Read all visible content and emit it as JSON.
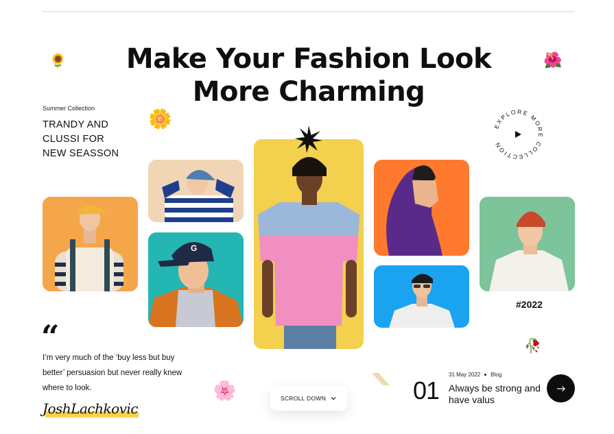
{
  "hero": {
    "title_line1": "Make Your Fashion Look",
    "title_line2": "More Charming"
  },
  "collection": {
    "label": "Summer Collection",
    "heading_line1": "TRANDY AND",
    "heading_line2": "CLUSSI FOR",
    "heading_line3": "NEW SEASSON"
  },
  "explore_badge": {
    "ring_text": "EXPLORE MORE COLLECTION",
    "icon": "play-icon"
  },
  "gallery": {
    "cards": [
      {
        "name": "model-yellow-cap",
        "bg": "#f6a64a"
      },
      {
        "name": "model-striped-sweater",
        "bg": "#f0d6b5"
      },
      {
        "name": "model-navy-cap",
        "bg": "#23b6b2"
      },
      {
        "name": "model-pink-tshirt",
        "bg": "#f3d04e"
      },
      {
        "name": "model-purple-hoodie",
        "bg": "#ff7a2e"
      },
      {
        "name": "model-glasses",
        "bg": "#1aa3f0"
      },
      {
        "name": "model-red-beanie",
        "bg": "#7ec49a"
      }
    ],
    "year_tag": "#2022"
  },
  "testimonial": {
    "quote_mark": "“",
    "text": "I’m very much of the ‘buy less but buy better’ persuasion but never really knew where to look.",
    "signature": "JoshLachkovic"
  },
  "scroll": {
    "label": "SCROLL DOWN",
    "icon": "chevron-down-icon"
  },
  "post": {
    "number": "01",
    "date": "31 May 2022",
    "category": "Blog",
    "title": "Always be strong and have valus",
    "icon": "arrow-right-icon"
  },
  "decorations": {
    "sunflower": "🌻",
    "hibiscus": "🌺",
    "blossom": "🌼",
    "cherry_blossom": "🌸",
    "wilted_flower": "🥀"
  },
  "colors": {
    "accent_yellow": "#f7d34b",
    "text": "#111111"
  }
}
